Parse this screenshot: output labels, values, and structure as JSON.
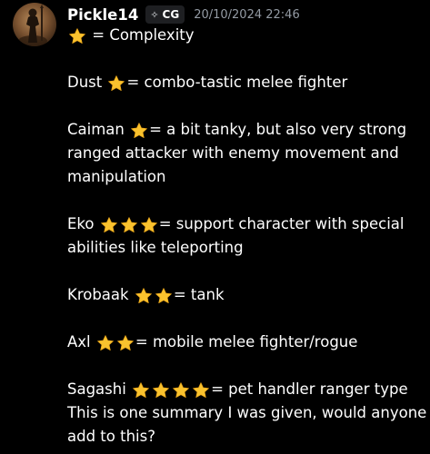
{
  "author": {
    "username": "Pickle14",
    "tag": "CG",
    "tag_icon": "sparkle-icon",
    "timestamp": "20/10/2024 22:46",
    "avatar": "character-portrait"
  },
  "colors": {
    "background": "#000000",
    "text": "#ffffff",
    "muted": "#949ba4",
    "star": "#f9c22e"
  },
  "message": {
    "legend_text": " = Complexity",
    "dust_name": "Dust ",
    "dust_desc": "= combo-tastic melee fighter",
    "caiman_name": "Caiman ",
    "caiman_desc": "= a bit tanky, but also very strong",
    "caiman_cont1": "ranged attacker with enemy movement and",
    "caiman_cont2": "manipulation",
    "eko_name": "Eko ",
    "eko_desc": "= support character with special",
    "eko_cont": "abilities like teleporting",
    "krobaak_name": "Krobaak ",
    "krobaak_desc": "= tank",
    "axl_name": "Axl ",
    "axl_desc": "= mobile melee fighter/rogue",
    "sagashi_name": "Sagashi ",
    "sagashi_desc": "= pet handler ranger type",
    "closing1": "This is one summary I was given, would anyone",
    "closing2": "add to this?"
  },
  "ratings": {
    "legend": 1,
    "dust": 1,
    "caiman": 1,
    "eko": 3,
    "krobaak": 2,
    "axl": 2,
    "sagashi": 4
  }
}
